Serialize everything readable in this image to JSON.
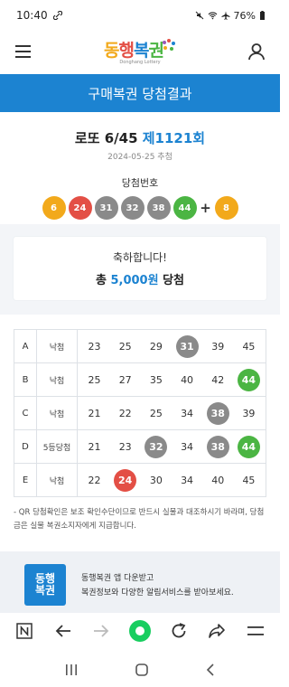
{
  "status_bar": {
    "time": "10:40",
    "battery": "76%"
  },
  "header": {
    "logo_text": "동행복권",
    "logo_sub": "Donghang Lottery"
  },
  "title_bar": {
    "title": "구매복권 당첨결과"
  },
  "draw": {
    "game": "로또 6/45",
    "round": "제1121회",
    "date": "2024-05-25 추첨",
    "win_label": "당첨번호",
    "numbers": [
      {
        "n": "6",
        "color": "#f2a91b"
      },
      {
        "n": "24",
        "color": "#e34f45"
      },
      {
        "n": "31",
        "color": "#8a8a8a"
      },
      {
        "n": "32",
        "color": "#8a8a8a"
      },
      {
        "n": "38",
        "color": "#8a8a8a"
      },
      {
        "n": "44",
        "color": "#4bb543"
      }
    ],
    "plus": "+",
    "bonus": {
      "n": "8",
      "color": "#f2a91b"
    }
  },
  "result": {
    "congrats": "축하합니다!",
    "prize_prefix": "총",
    "prize_amount": "5,000원",
    "prize_suffix": "당첨"
  },
  "ticket": [
    {
      "lane": "A",
      "result": "낙첨",
      "numbers": [
        "23",
        "25",
        "29",
        "31",
        "39",
        "45"
      ],
      "hits": [
        null,
        null,
        null,
        "#8a8a8a",
        null,
        null
      ]
    },
    {
      "lane": "B",
      "result": "낙첨",
      "numbers": [
        "25",
        "27",
        "35",
        "40",
        "42",
        "44"
      ],
      "hits": [
        null,
        null,
        null,
        null,
        null,
        "#4bb543"
      ]
    },
    {
      "lane": "C",
      "result": "낙첨",
      "numbers": [
        "21",
        "22",
        "25",
        "34",
        "38",
        "39"
      ],
      "hits": [
        null,
        null,
        null,
        null,
        "#8a8a8a",
        null
      ]
    },
    {
      "lane": "D",
      "result": "5등당첨",
      "numbers": [
        "21",
        "23",
        "32",
        "34",
        "38",
        "44"
      ],
      "hits": [
        null,
        null,
        "#8a8a8a",
        null,
        "#8a8a8a",
        "#4bb543"
      ]
    },
    {
      "lane": "E",
      "result": "낙첨",
      "numbers": [
        "22",
        "24",
        "30",
        "34",
        "40",
        "45"
      ],
      "hits": [
        null,
        "#e34f45",
        null,
        null,
        null,
        null
      ]
    }
  ],
  "notice": "- QR 당첨확인은 보조 확인수단이므로 반드시 실물과 대조하시기 바라며, 당첨금은 실물 복권소지자에게 지급합니다.",
  "promo": {
    "logo_text": "동행\n복권",
    "line1": "동행복권 앱 다운받고",
    "line2": "복권정보와 다양한 알림서비스를 받아보세요."
  },
  "colors": {
    "accent": "#1c83d1",
    "ball_yellow": "#f2a91b",
    "ball_red": "#e34f45",
    "ball_gray": "#8a8a8a",
    "ball_green": "#4bb543"
  },
  "icons": [
    "hamburger-menu-icon",
    "user-icon",
    "back-arrow-icon",
    "forward-arrow-icon",
    "home-icon",
    "refresh-icon",
    "share-icon",
    "browser-menu-icon"
  ]
}
